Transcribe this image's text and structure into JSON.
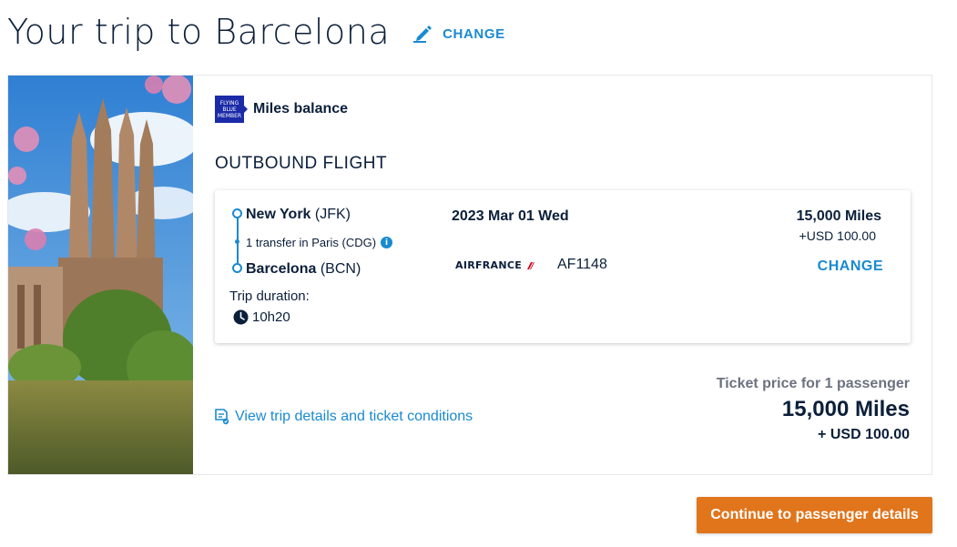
{
  "header": {
    "title": "Your trip to Barcelona",
    "change_label": "CHANGE"
  },
  "miles": {
    "logo_text": [
      "FLYING",
      "BLUE",
      "MEMBER"
    ],
    "label": "Miles balance"
  },
  "outbound": {
    "section_title": "OUTBOUND FLIGHT",
    "origin_city": "New York",
    "origin_code": "(JFK)",
    "transfer": "1 transfer in Paris (CDG)",
    "dest_city": "Barcelona",
    "dest_code": "(BCN)",
    "duration_label": "Trip duration:",
    "duration": "10h20",
    "date": "2023 Mar 01 Wed",
    "airline": "AIRFRANCE",
    "flight_number": "AF1148",
    "price_miles": "15,000 Miles",
    "price_usd": "+USD 100.00",
    "change_label": "CHANGE"
  },
  "details_link": "View trip details and ticket conditions",
  "summary": {
    "ticket_label": "Ticket price for 1 passenger",
    "total_miles": "15,000 Miles",
    "total_usd": "+ USD 100.00"
  },
  "continue_button": "Continue to passenger details",
  "colors": {
    "accent": "#1a8ad0",
    "cta": "#e0751c",
    "text": "#0b1f3a",
    "flying_blue": "#1b2ba8"
  },
  "icons": [
    "pencil-icon",
    "info-icon",
    "clock-icon",
    "document-icon",
    "airline-logo"
  ]
}
